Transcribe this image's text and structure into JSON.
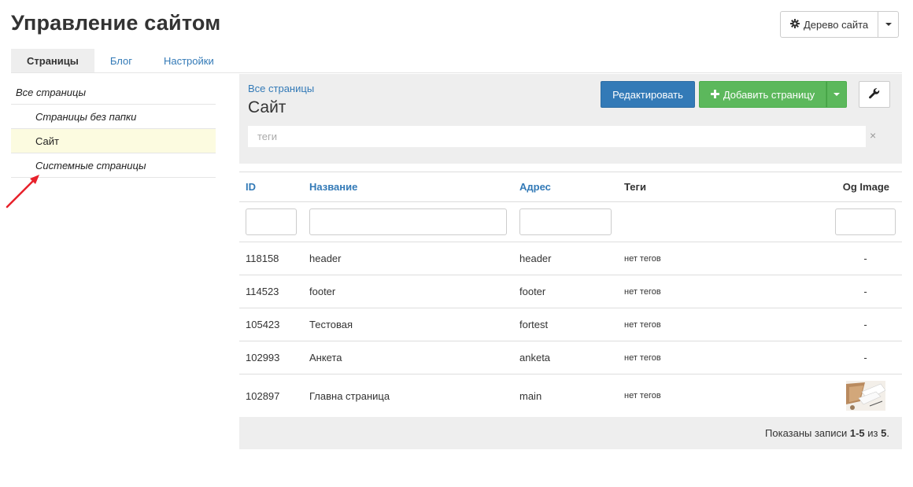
{
  "page": {
    "title": "Управление сайтом"
  },
  "header": {
    "site_tree_label": "Дерево сайта",
    "site_tree_icon": "gear-icon"
  },
  "tabs": [
    {
      "label": "Страницы",
      "active": true
    },
    {
      "label": "Блог",
      "active": false
    },
    {
      "label": "Настройки",
      "active": false
    }
  ],
  "sidebar": {
    "items": [
      {
        "label": "Все страницы"
      },
      {
        "label": "Страницы без папки"
      },
      {
        "label": "Сайт",
        "selected": true
      },
      {
        "label": "Системные страницы"
      }
    ]
  },
  "panel": {
    "breadcrumb": "Все страницы",
    "folder_title": "Сайт",
    "edit_label": "Редактировать",
    "add_label": "Добавить страницу",
    "tags_placeholder": "теги",
    "tags_clear": "×"
  },
  "table": {
    "columns": {
      "id": "ID",
      "name": "Название",
      "address": "Адрес",
      "tags": "Теги",
      "og": "Og Image"
    },
    "rows": [
      {
        "id": "118158",
        "name": "header",
        "address": "header",
        "tags": "нет тегов",
        "og": "-"
      },
      {
        "id": "114523",
        "name": "footer",
        "address": "footer",
        "tags": "нет тегов",
        "og": "-"
      },
      {
        "id": "105423",
        "name": "Тестовая",
        "address": "fortest",
        "tags": "нет тегов",
        "og": "-"
      },
      {
        "id": "102993",
        "name": "Анкета",
        "address": "anketa",
        "tags": "нет тегов",
        "og": "-"
      },
      {
        "id": "102897",
        "name": "Главна страница",
        "address": "main",
        "tags": "нет тегов",
        "og": ""
      }
    ]
  },
  "summary": {
    "prefix": "Показаны записи",
    "range": "1-5",
    "of": "из",
    "total": "5",
    "suffix": "."
  },
  "colors": {
    "primary": "#337ab7",
    "success": "#5cb85c",
    "panel": "#eeeeee",
    "selected_row": "#fcfbe0",
    "annotation_arrow": "#e8212b"
  }
}
